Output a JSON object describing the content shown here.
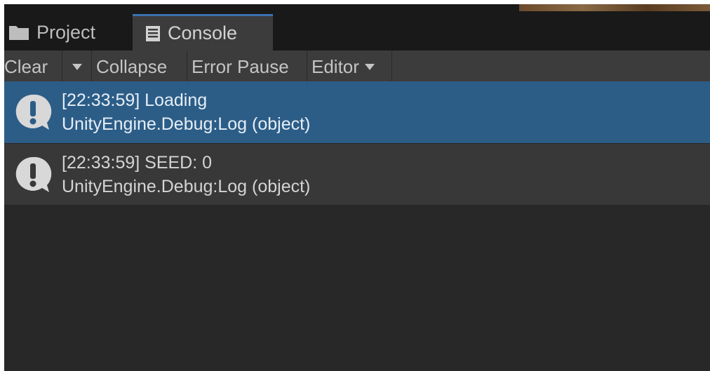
{
  "tabs": [
    {
      "label": "Project",
      "icon": "folder-icon",
      "active": false
    },
    {
      "label": "Console",
      "icon": "console-icon",
      "active": true
    }
  ],
  "toolbar": {
    "clear_label": "Clear",
    "collapse_label": "Collapse",
    "error_pause_label": "Error Pause",
    "editor_label": "Editor"
  },
  "logs": [
    {
      "message": "[22:33:59] Loading",
      "trace": "UnityEngine.Debug:Log (object)",
      "selected": true,
      "icon": "info-bubble-icon"
    },
    {
      "message": "[22:33:59] SEED: 0",
      "trace": "UnityEngine.Debug:Log (object)",
      "selected": false,
      "icon": "info-bubble-icon"
    }
  ],
  "colors": {
    "selected_row": "#2c5d87",
    "tab_accent": "#3a72b0",
    "panel_bg": "#282828"
  }
}
